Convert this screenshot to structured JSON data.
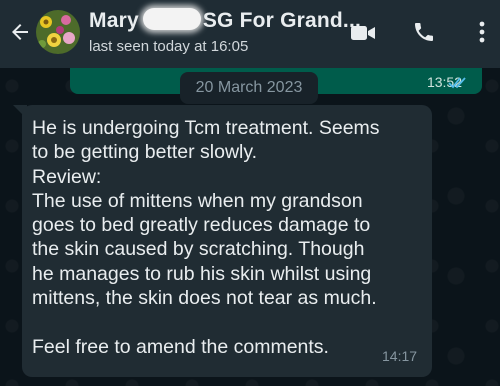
{
  "header": {
    "contact_first": "Mary",
    "contact_rest": "SG For Grand...",
    "status": "last seen today at 16:05",
    "icons": [
      "back-arrow-icon",
      "video-call-icon",
      "phone-icon",
      "more-options-icon"
    ]
  },
  "chat": {
    "date_label": "20 March 2023",
    "sent_message": {
      "time": "13:52",
      "status": "read"
    },
    "received_message": {
      "text": "He is undergoing Tcm treatment. Seems\nto be getting better slowly.\nReview:\nThe use of mittens when my grandson\ngoes to bed greatly reduces damage to\nthe skin caused by scratching. Though\nhe manages to rub his skin whilst using\nmittens, the skin does not tear as much.\n\nFeel free to amend the comments.",
      "time": "14:17"
    }
  },
  "colors": {
    "header_bg": "#1f2c34",
    "chat_bg": "#0b141a",
    "sent_bubble": "#005c4b",
    "received_bubble": "#202c33",
    "read_ticks": "#53bdeb"
  }
}
